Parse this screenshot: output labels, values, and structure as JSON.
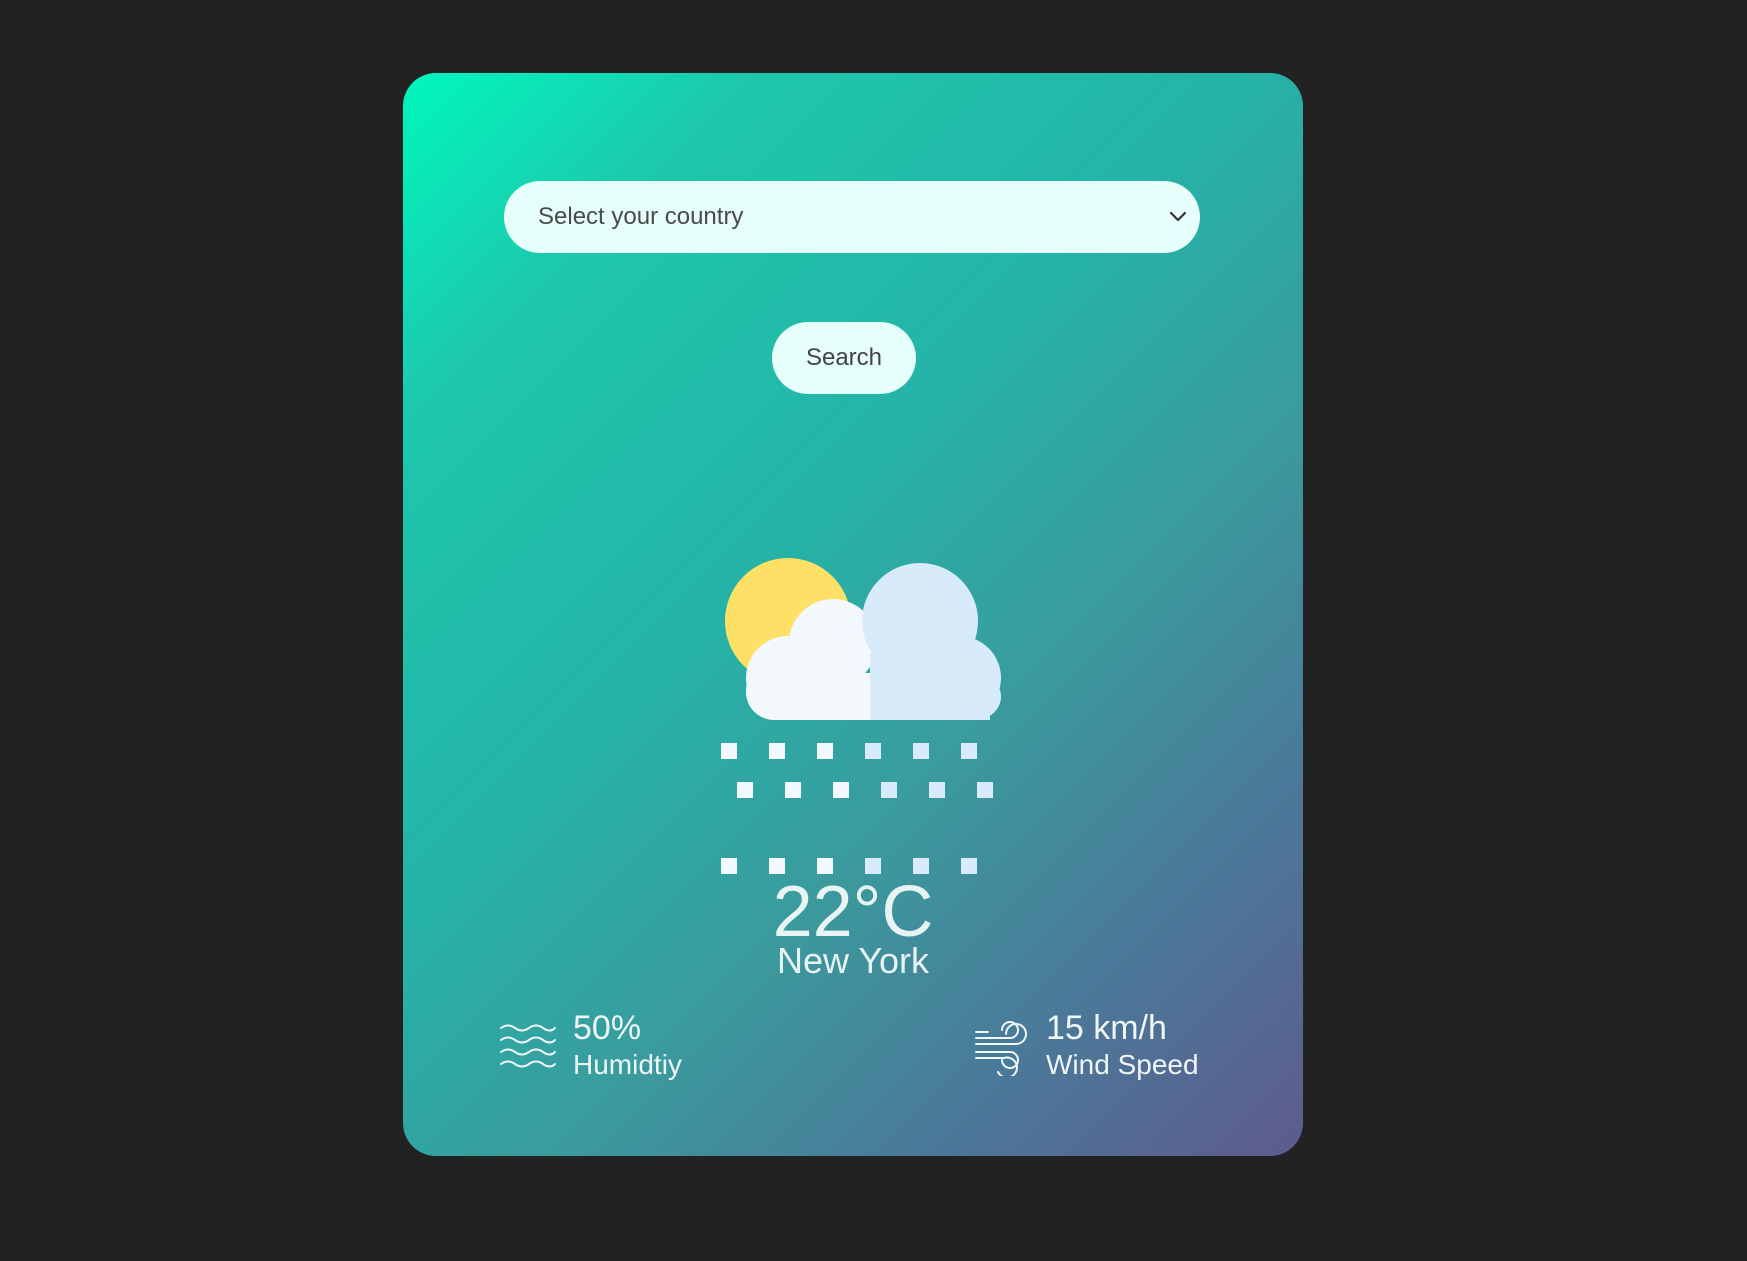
{
  "search": {
    "select_placeholder": "Select your country",
    "button_label": "Search"
  },
  "weather": {
    "icon": "cloud-sun-snow-icon",
    "temperature": "22°C",
    "city": "New York"
  },
  "humidity": {
    "value": "50%",
    "label": "Humidtiy",
    "icon": "humidity-waves-icon"
  },
  "wind": {
    "value": "15 km/h",
    "label": "Wind Speed",
    "icon": "wind-icon"
  },
  "colors": {
    "page_background": "#222222",
    "card_gradient_start": "#00f7bd",
    "card_gradient_end": "#5e5a8e",
    "input_background": "#e6fffb",
    "sun": "#ffe066",
    "cloud_light": "#f2f8fb",
    "cloud_shade": "#d8ebfb"
  }
}
